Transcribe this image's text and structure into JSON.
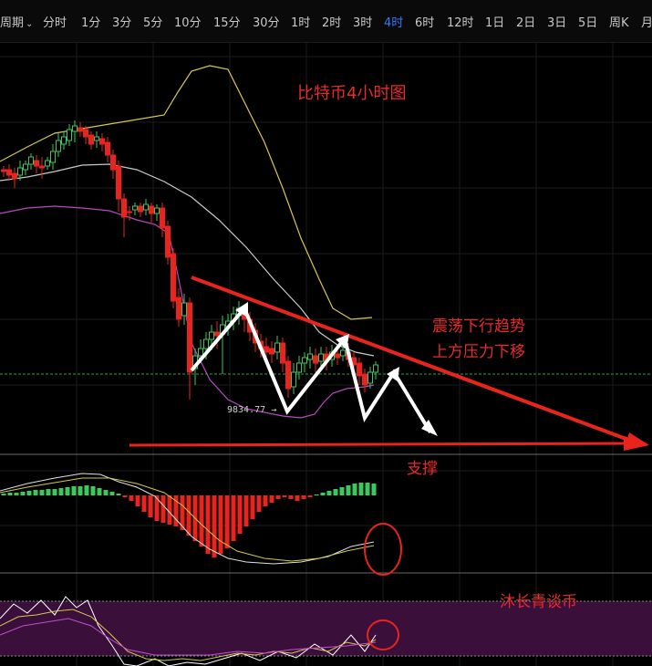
{
  "toolbar": {
    "period_label": "周期",
    "period_caret": "⌄",
    "tabs": [
      {
        "label": "分时"
      },
      {
        "label": "1分"
      },
      {
        "label": "3分"
      },
      {
        "label": "5分"
      },
      {
        "label": "10分"
      },
      {
        "label": "15分"
      },
      {
        "label": "30分"
      },
      {
        "label": "1时"
      },
      {
        "label": "2时"
      },
      {
        "label": "3时"
      },
      {
        "label": "4时"
      },
      {
        "label": "6时"
      },
      {
        "label": "12时"
      },
      {
        "label": "1日"
      },
      {
        "label": "2日"
      },
      {
        "label": "3日"
      },
      {
        "label": "5日"
      },
      {
        "label": "周K"
      },
      {
        "label": "月"
      }
    ],
    "active_tab": "4时",
    "active_color": "#2f7bff"
  },
  "chart": {
    "title": "比特币4小时图",
    "annotation_trend_1": "震荡下行趋势",
    "annotation_trend_2": "上方压力下移",
    "annotation_support": "支撑",
    "watermark": "沐长青谈币",
    "low_label": "9834.77",
    "low_arrow": "→",
    "colors": {
      "up": "#3cc85a",
      "down": "#e8241c",
      "annotation": "#e52b2b",
      "upper_band": "#d6c84a",
      "mid_band": "#c9c9c9",
      "lower_band": "#b848c0",
      "rsi_fill": "#3a0f3a",
      "current_price_line": "#2f9e3f"
    }
  }
}
